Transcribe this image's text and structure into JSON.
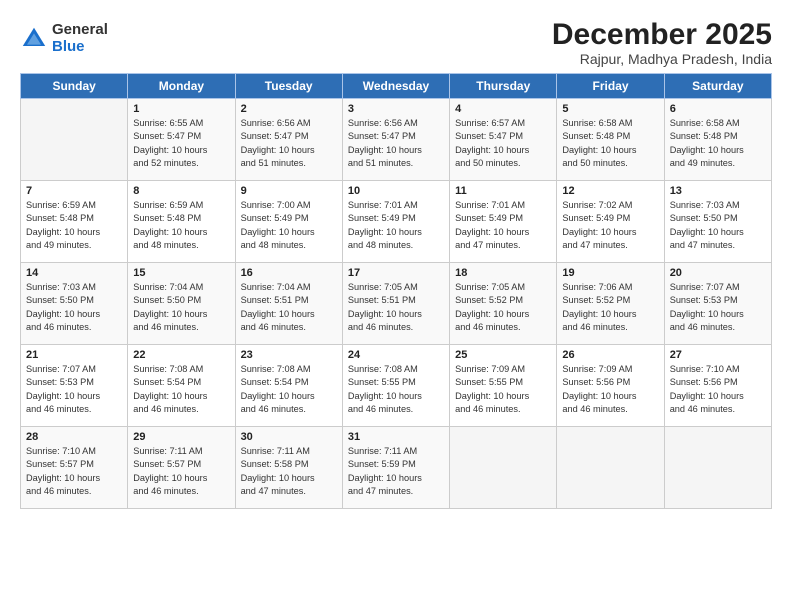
{
  "logo": {
    "general": "General",
    "blue": "Blue"
  },
  "title": "December 2025",
  "subtitle": "Rajpur, Madhya Pradesh, India",
  "days_of_week": [
    "Sunday",
    "Monday",
    "Tuesday",
    "Wednesday",
    "Thursday",
    "Friday",
    "Saturday"
  ],
  "weeks": [
    [
      {
        "day": "",
        "info": ""
      },
      {
        "day": "1",
        "info": "Sunrise: 6:55 AM\nSunset: 5:47 PM\nDaylight: 10 hours\nand 52 minutes."
      },
      {
        "day": "2",
        "info": "Sunrise: 6:56 AM\nSunset: 5:47 PM\nDaylight: 10 hours\nand 51 minutes."
      },
      {
        "day": "3",
        "info": "Sunrise: 6:56 AM\nSunset: 5:47 PM\nDaylight: 10 hours\nand 51 minutes."
      },
      {
        "day": "4",
        "info": "Sunrise: 6:57 AM\nSunset: 5:47 PM\nDaylight: 10 hours\nand 50 minutes."
      },
      {
        "day": "5",
        "info": "Sunrise: 6:58 AM\nSunset: 5:48 PM\nDaylight: 10 hours\nand 50 minutes."
      },
      {
        "day": "6",
        "info": "Sunrise: 6:58 AM\nSunset: 5:48 PM\nDaylight: 10 hours\nand 49 minutes."
      }
    ],
    [
      {
        "day": "7",
        "info": "Sunrise: 6:59 AM\nSunset: 5:48 PM\nDaylight: 10 hours\nand 49 minutes."
      },
      {
        "day": "8",
        "info": "Sunrise: 6:59 AM\nSunset: 5:48 PM\nDaylight: 10 hours\nand 48 minutes."
      },
      {
        "day": "9",
        "info": "Sunrise: 7:00 AM\nSunset: 5:49 PM\nDaylight: 10 hours\nand 48 minutes."
      },
      {
        "day": "10",
        "info": "Sunrise: 7:01 AM\nSunset: 5:49 PM\nDaylight: 10 hours\nand 48 minutes."
      },
      {
        "day": "11",
        "info": "Sunrise: 7:01 AM\nSunset: 5:49 PM\nDaylight: 10 hours\nand 47 minutes."
      },
      {
        "day": "12",
        "info": "Sunrise: 7:02 AM\nSunset: 5:49 PM\nDaylight: 10 hours\nand 47 minutes."
      },
      {
        "day": "13",
        "info": "Sunrise: 7:03 AM\nSunset: 5:50 PM\nDaylight: 10 hours\nand 47 minutes."
      }
    ],
    [
      {
        "day": "14",
        "info": "Sunrise: 7:03 AM\nSunset: 5:50 PM\nDaylight: 10 hours\nand 46 minutes."
      },
      {
        "day": "15",
        "info": "Sunrise: 7:04 AM\nSunset: 5:50 PM\nDaylight: 10 hours\nand 46 minutes."
      },
      {
        "day": "16",
        "info": "Sunrise: 7:04 AM\nSunset: 5:51 PM\nDaylight: 10 hours\nand 46 minutes."
      },
      {
        "day": "17",
        "info": "Sunrise: 7:05 AM\nSunset: 5:51 PM\nDaylight: 10 hours\nand 46 minutes."
      },
      {
        "day": "18",
        "info": "Sunrise: 7:05 AM\nSunset: 5:52 PM\nDaylight: 10 hours\nand 46 minutes."
      },
      {
        "day": "19",
        "info": "Sunrise: 7:06 AM\nSunset: 5:52 PM\nDaylight: 10 hours\nand 46 minutes."
      },
      {
        "day": "20",
        "info": "Sunrise: 7:07 AM\nSunset: 5:53 PM\nDaylight: 10 hours\nand 46 minutes."
      }
    ],
    [
      {
        "day": "21",
        "info": "Sunrise: 7:07 AM\nSunset: 5:53 PM\nDaylight: 10 hours\nand 46 minutes."
      },
      {
        "day": "22",
        "info": "Sunrise: 7:08 AM\nSunset: 5:54 PM\nDaylight: 10 hours\nand 46 minutes."
      },
      {
        "day": "23",
        "info": "Sunrise: 7:08 AM\nSunset: 5:54 PM\nDaylight: 10 hours\nand 46 minutes."
      },
      {
        "day": "24",
        "info": "Sunrise: 7:08 AM\nSunset: 5:55 PM\nDaylight: 10 hours\nand 46 minutes."
      },
      {
        "day": "25",
        "info": "Sunrise: 7:09 AM\nSunset: 5:55 PM\nDaylight: 10 hours\nand 46 minutes."
      },
      {
        "day": "26",
        "info": "Sunrise: 7:09 AM\nSunset: 5:56 PM\nDaylight: 10 hours\nand 46 minutes."
      },
      {
        "day": "27",
        "info": "Sunrise: 7:10 AM\nSunset: 5:56 PM\nDaylight: 10 hours\nand 46 minutes."
      }
    ],
    [
      {
        "day": "28",
        "info": "Sunrise: 7:10 AM\nSunset: 5:57 PM\nDaylight: 10 hours\nand 46 minutes."
      },
      {
        "day": "29",
        "info": "Sunrise: 7:11 AM\nSunset: 5:57 PM\nDaylight: 10 hours\nand 46 minutes."
      },
      {
        "day": "30",
        "info": "Sunrise: 7:11 AM\nSunset: 5:58 PM\nDaylight: 10 hours\nand 47 minutes."
      },
      {
        "day": "31",
        "info": "Sunrise: 7:11 AM\nSunset: 5:59 PM\nDaylight: 10 hours\nand 47 minutes."
      },
      {
        "day": "",
        "info": ""
      },
      {
        "day": "",
        "info": ""
      },
      {
        "day": "",
        "info": ""
      }
    ]
  ]
}
